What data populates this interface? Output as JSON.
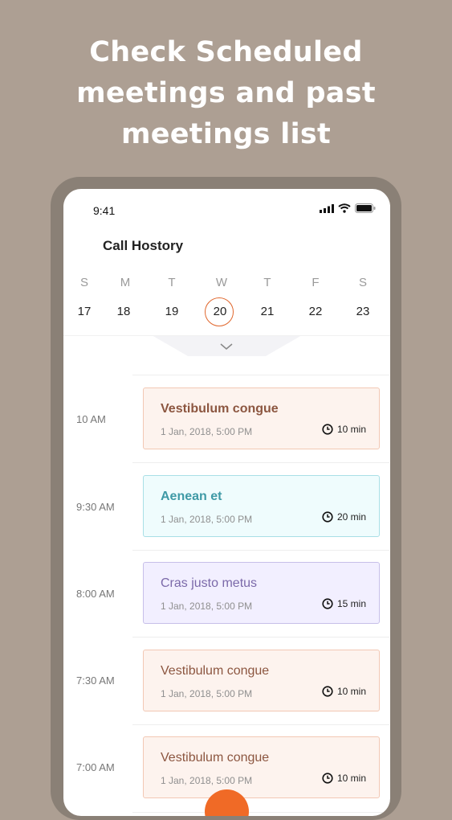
{
  "headline": {
    "line1": "Check Scheduled",
    "line2": "meetings and past",
    "line3": "meetings list"
  },
  "status_bar": {
    "time": "9:41"
  },
  "page_title": "Call Hostory",
  "calendar": {
    "days": [
      {
        "letter": "S",
        "num": "17"
      },
      {
        "letter": "M",
        "num": "18"
      },
      {
        "letter": "T",
        "num": "19"
      },
      {
        "letter": "W",
        "num": "20"
      },
      {
        "letter": "T",
        "num": "21"
      },
      {
        "letter": "F",
        "num": "22"
      },
      {
        "letter": "S",
        "num": "23"
      }
    ],
    "selected_day": "20"
  },
  "meetings": [
    {
      "time": "10 AM",
      "title": "Vestibulum congue",
      "date": "1 Jan, 2018, 5:00 PM",
      "duration": "10 min",
      "bold": true,
      "title_color": "#8c5640",
      "bg": "#fdf3ee",
      "border": "#f2c8b4"
    },
    {
      "time": "9:30 AM",
      "title": "Aenean et",
      "date": "1 Jan, 2018, 5:00 PM",
      "duration": "20 min",
      "bold": true,
      "title_color": "#3f9aa6",
      "bg": "#effcfd",
      "border": "#a9dfe6"
    },
    {
      "time": "8:00 AM",
      "title": "Cras justo metus",
      "date": "1 Jan, 2018, 5:00 PM",
      "duration": "15 min",
      "bold": false,
      "title_color": "#7b69a9",
      "bg": "#f2efff",
      "border": "#c7bfe9"
    },
    {
      "time": "7:30 AM",
      "title": "Vestibulum congue",
      "date": "1 Jan, 2018, 5:00 PM",
      "duration": "10 min",
      "bold": false,
      "title_color": "#8c5640",
      "bg": "#fdf3ee",
      "border": "#f2c8b4"
    },
    {
      "time": "7:00 AM",
      "title": "Vestibulum congue",
      "date": "1 Jan, 2018, 5:00 PM",
      "duration": "10 min",
      "bold": false,
      "title_color": "#8c5640",
      "bg": "#fdf3ee",
      "border": "#f2c8b4"
    }
  ],
  "fab": {
    "color": "#f06a26",
    "icon": "add-icon"
  }
}
